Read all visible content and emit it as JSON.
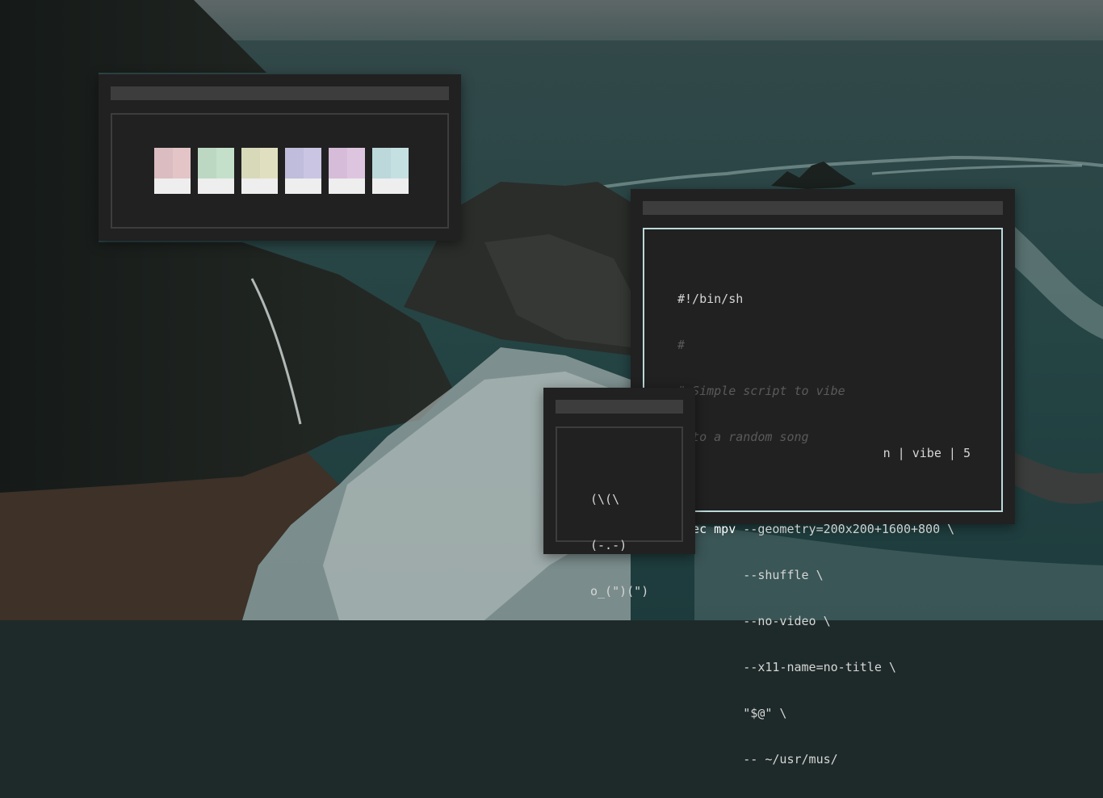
{
  "palette": {
    "swatches": [
      {
        "name": "red",
        "shades": [
          "#dbbcc0",
          "#e3c4c7"
        ]
      },
      {
        "name": "green",
        "shades": [
          "#bcd8c2",
          "#c4e0ca"
        ]
      },
      {
        "name": "yellow",
        "shades": [
          "#d8d9b8",
          "#e0e0c1"
        ]
      },
      {
        "name": "blue",
        "shades": [
          "#c0bcdb",
          "#c9c5e3"
        ]
      },
      {
        "name": "magenta",
        "shades": [
          "#d6bcd8",
          "#dec5df"
        ]
      },
      {
        "name": "cyan",
        "shades": [
          "#bcd8da",
          "#c5e0e1"
        ]
      }
    ],
    "bottom_color": "#eeeeee"
  },
  "terminal": {
    "lines": {
      "shebang": "#!/bin/sh",
      "c1": "#",
      "c2": "# Simple script to vibe",
      "c3": "# to a random song",
      "exec_kw": "exec",
      "exec_cmd": "mpv",
      "exec_arg": "--geometry=200x200+1600+800 \\",
      "a1": "         --shuffle \\",
      "a2": "         --no-video \\",
      "a3": "         --x11-name=no-title \\",
      "a4": "         \"$@\" \\",
      "a5": "         -- ~/usr/mus/"
    },
    "status": "n | vibe | 5",
    "border_color": "#bcd9d9"
  },
  "bunny": {
    "l1": "(\\(\\",
    "l2": "(-.-)",
    "l3": "o_(\")(\")"
  }
}
